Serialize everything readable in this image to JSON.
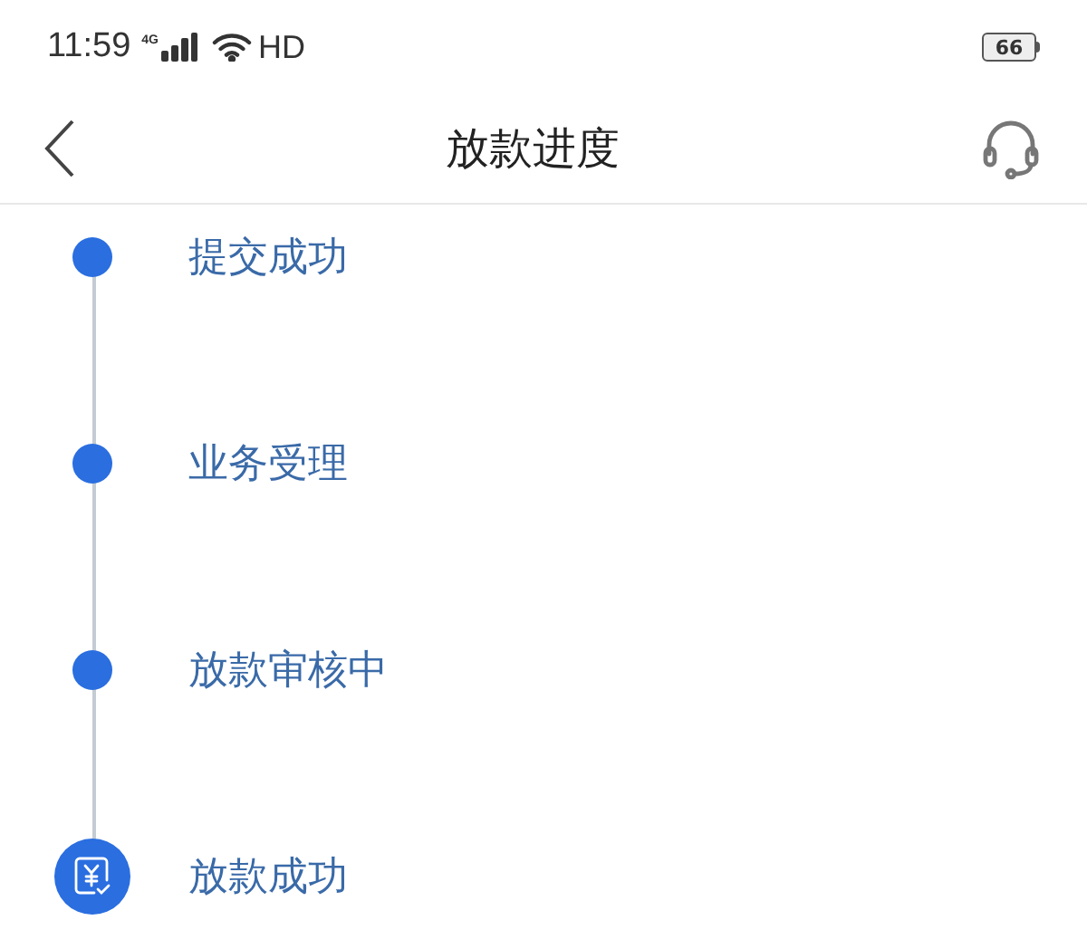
{
  "status_bar": {
    "time": "11:59",
    "network": "4G",
    "hd": "HD",
    "battery": "66"
  },
  "header": {
    "title": "放款进度"
  },
  "steps": [
    {
      "kind": "dot",
      "label": "提交成功"
    },
    {
      "kind": "dot",
      "label": "业务受理"
    },
    {
      "kind": "dot",
      "label": "放款审核中"
    },
    {
      "kind": "final",
      "label": "放款成功"
    }
  ]
}
